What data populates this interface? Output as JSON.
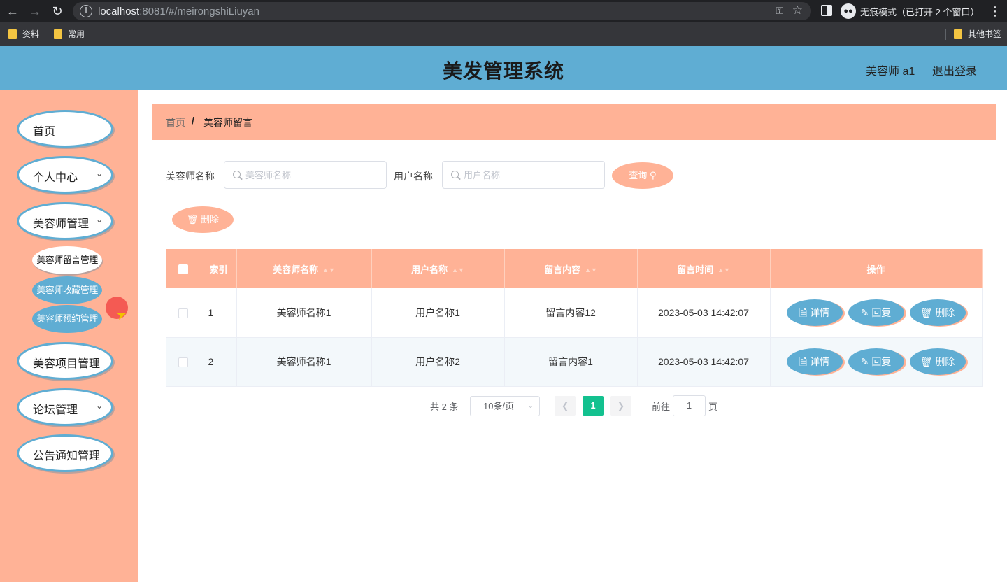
{
  "browser": {
    "url_host": "localhost",
    "url_rest": ":8081/#/meirongshiLiuyan",
    "incognito_label": "无痕模式（已打开 2 个窗口）",
    "bookmarks": [
      "资料",
      "常用"
    ],
    "other_bookmarks": "其他书签"
  },
  "header": {
    "title": "美发管理系统",
    "user": "美容师 a1",
    "logout": "退出登录"
  },
  "sidebar": {
    "items": [
      {
        "label": "首页"
      },
      {
        "label": "个人中心"
      },
      {
        "label": "美容师管理"
      },
      {
        "label": "美容项目管理"
      },
      {
        "label": "论坛管理"
      },
      {
        "label": "公告通知管理"
      }
    ],
    "sub_items": [
      {
        "label": "美容师留言管理"
      },
      {
        "label": "美容师收藏管理"
      },
      {
        "label": "美容师预约管理"
      }
    ]
  },
  "breadcrumb": {
    "home": "首页",
    "separator": "/",
    "current": "美容师留言"
  },
  "search": {
    "field1_label": "美容师名称",
    "field1_placeholder": "美容师名称",
    "field2_label": "用户名称",
    "field2_placeholder": "用户名称",
    "query_button": "查询",
    "delete_button": "删除"
  },
  "table": {
    "headers": [
      "索引",
      "美容师名称",
      "用户名称",
      "留言内容",
      "留言时间",
      "操作"
    ],
    "rows": [
      {
        "index": "1",
        "beautician": "美容师名称1",
        "user": "用户名称1",
        "content": "留言内容12",
        "time": "2023-05-03 14:42:07"
      },
      {
        "index": "2",
        "beautician": "美容师名称1",
        "user": "用户名称2",
        "content": "留言内容1",
        "time": "2023-05-03 14:42:07"
      }
    ],
    "actions": {
      "detail": "详情",
      "reply": "回复",
      "delete": "删除"
    }
  },
  "pagination": {
    "total": "共 2 条",
    "page_size": "10条/页",
    "current_page": "1",
    "goto_label": "前往",
    "goto_value": "1",
    "page_unit": "页"
  },
  "colors": {
    "accent": "#ffb296",
    "primary": "#5fadd3",
    "pager_active": "#13c18f"
  }
}
